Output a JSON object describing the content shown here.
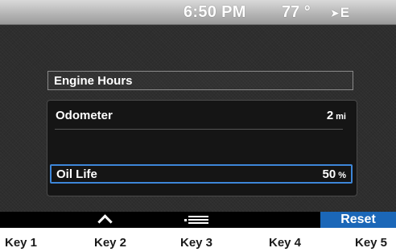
{
  "status_bar": {
    "time": "6:50 PM",
    "temperature": "77 °",
    "compass_heading": "E",
    "compass_icon": "heading-arrow-icon"
  },
  "menu": {
    "engine_hours_label": "Engine Hours",
    "odometer": {
      "label": "Odometer",
      "value": "2",
      "unit": "mi"
    },
    "oil_life": {
      "label": "Oil Life",
      "value": "50",
      "unit": "%",
      "selected": true
    }
  },
  "softkeys": {
    "key2_icon": "chevron-up-icon",
    "key3_icon": "menu-icon",
    "key5_label": "Reset",
    "highlight_color": "#1b67b8"
  },
  "key_labels": [
    "Key 1",
    "Key 2",
    "Key 3",
    "Key 4",
    "Key 5"
  ],
  "colors": {
    "selection_border": "#3d86d8",
    "background": "#2e2e2e"
  }
}
